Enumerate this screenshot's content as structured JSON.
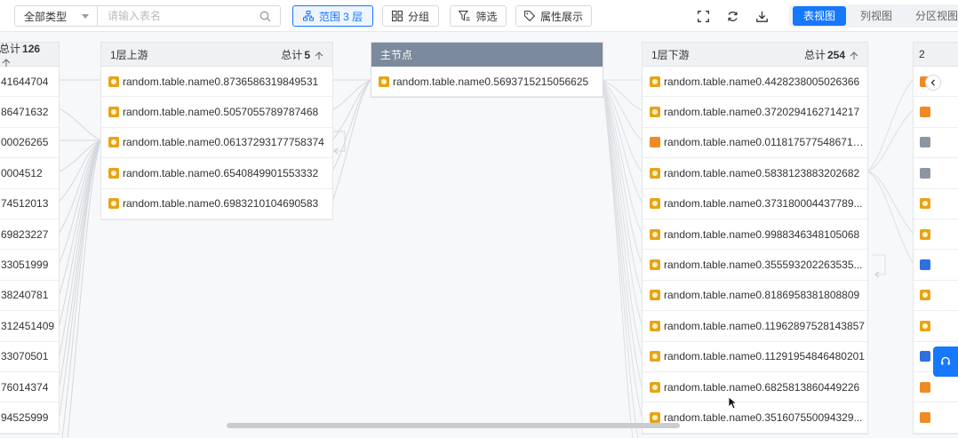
{
  "toolbar": {
    "type_select": "全部类型",
    "search_placeholder": "请输入表名",
    "scope_label": "范围 3 层",
    "group_label": "分组",
    "filter_label": "筛选",
    "attr_label": "属性展示",
    "views": [
      "表视图",
      "列视图",
      "分区视图"
    ],
    "active_view": "表视图"
  },
  "left_partial": {
    "total_prefix": "总计",
    "total_value": "126",
    "rows": [
      "41644704",
      "86471632",
      "00026265",
      "0004512",
      "74512013",
      "69823227",
      "33051999",
      "38240781",
      "312451409",
      "33070501",
      "76014374",
      "94525999"
    ]
  },
  "upstream": {
    "title": "1层上游",
    "total_prefix": "总计",
    "total_value": "5",
    "rows": [
      "random.table.name0.8736586319849531",
      "random.table.name0.5057055789787468",
      "random.table.name0.06137293177758374",
      "random.table.name0.6540849901553332",
      "random.table.name0.6983210104690583"
    ]
  },
  "main_node": {
    "title": "主节点",
    "rows": [
      "random.table.name0.5693715215056625"
    ]
  },
  "downstream": {
    "title": "1层下游",
    "total_prefix": "总计",
    "total_value": "254",
    "rows": [
      {
        "label": "random.table.name0.4428238005026366",
        "icon": "yellow"
      },
      {
        "label": "random.table.name0.3720294162714217",
        "icon": "yellow"
      },
      {
        "label": "random.table.name0.0118175775486717...",
        "icon": "orange"
      },
      {
        "label": "random.table.name0.5838123883202682",
        "icon": "yellow"
      },
      {
        "label": "random.table.name0.373180004437789...",
        "icon": "yellow"
      },
      {
        "label": "random.table.name0.9988346348105068",
        "icon": "yellow"
      },
      {
        "label": "random.table.name0.355593202263535...",
        "icon": "yellow"
      },
      {
        "label": "random.table.name0.8186958381808809",
        "icon": "yellow"
      },
      {
        "label": "random.table.name0.11962897528143857",
        "icon": "yellow"
      },
      {
        "label": "random.table.name0.11291954846480201",
        "icon": "yellow"
      },
      {
        "label": "random.table.name0.6825813860449226",
        "icon": "yellow"
      },
      {
        "label": "random.table.name0.351607550094329...",
        "icon": "yellow"
      }
    ]
  },
  "right_partial": {
    "title": "2",
    "icons": [
      "orange",
      "orange",
      "gray",
      "gray",
      "yellow",
      "yellow",
      "blue",
      "yellow",
      "yellow",
      "blue",
      "orange",
      "orange"
    ]
  },
  "colors": {
    "accent": "#1677ff",
    "main_header": "#7b8a9c",
    "table_icon": "#e8a317",
    "stream_icon": "#f08a24",
    "db_icon": "#2f6fe0"
  }
}
